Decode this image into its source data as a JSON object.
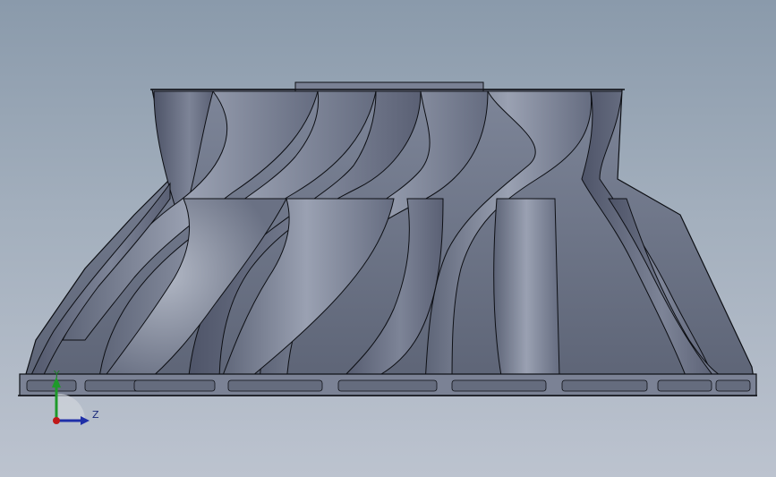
{
  "viewport": {
    "background_top": "#8a9aab",
    "background_bottom": "#bcc3cf"
  },
  "model": {
    "shape": "impeller-side-view",
    "blade_color": "#6e7688",
    "blade_highlight": "#9aa1b2",
    "edge_color": "#0d0f14"
  },
  "triad": {
    "y_label": "Y",
    "z_label": "Z",
    "y_color": "#1e9a2a",
    "z_color": "#1f2fa8",
    "x_origin_color": "#c01818"
  }
}
